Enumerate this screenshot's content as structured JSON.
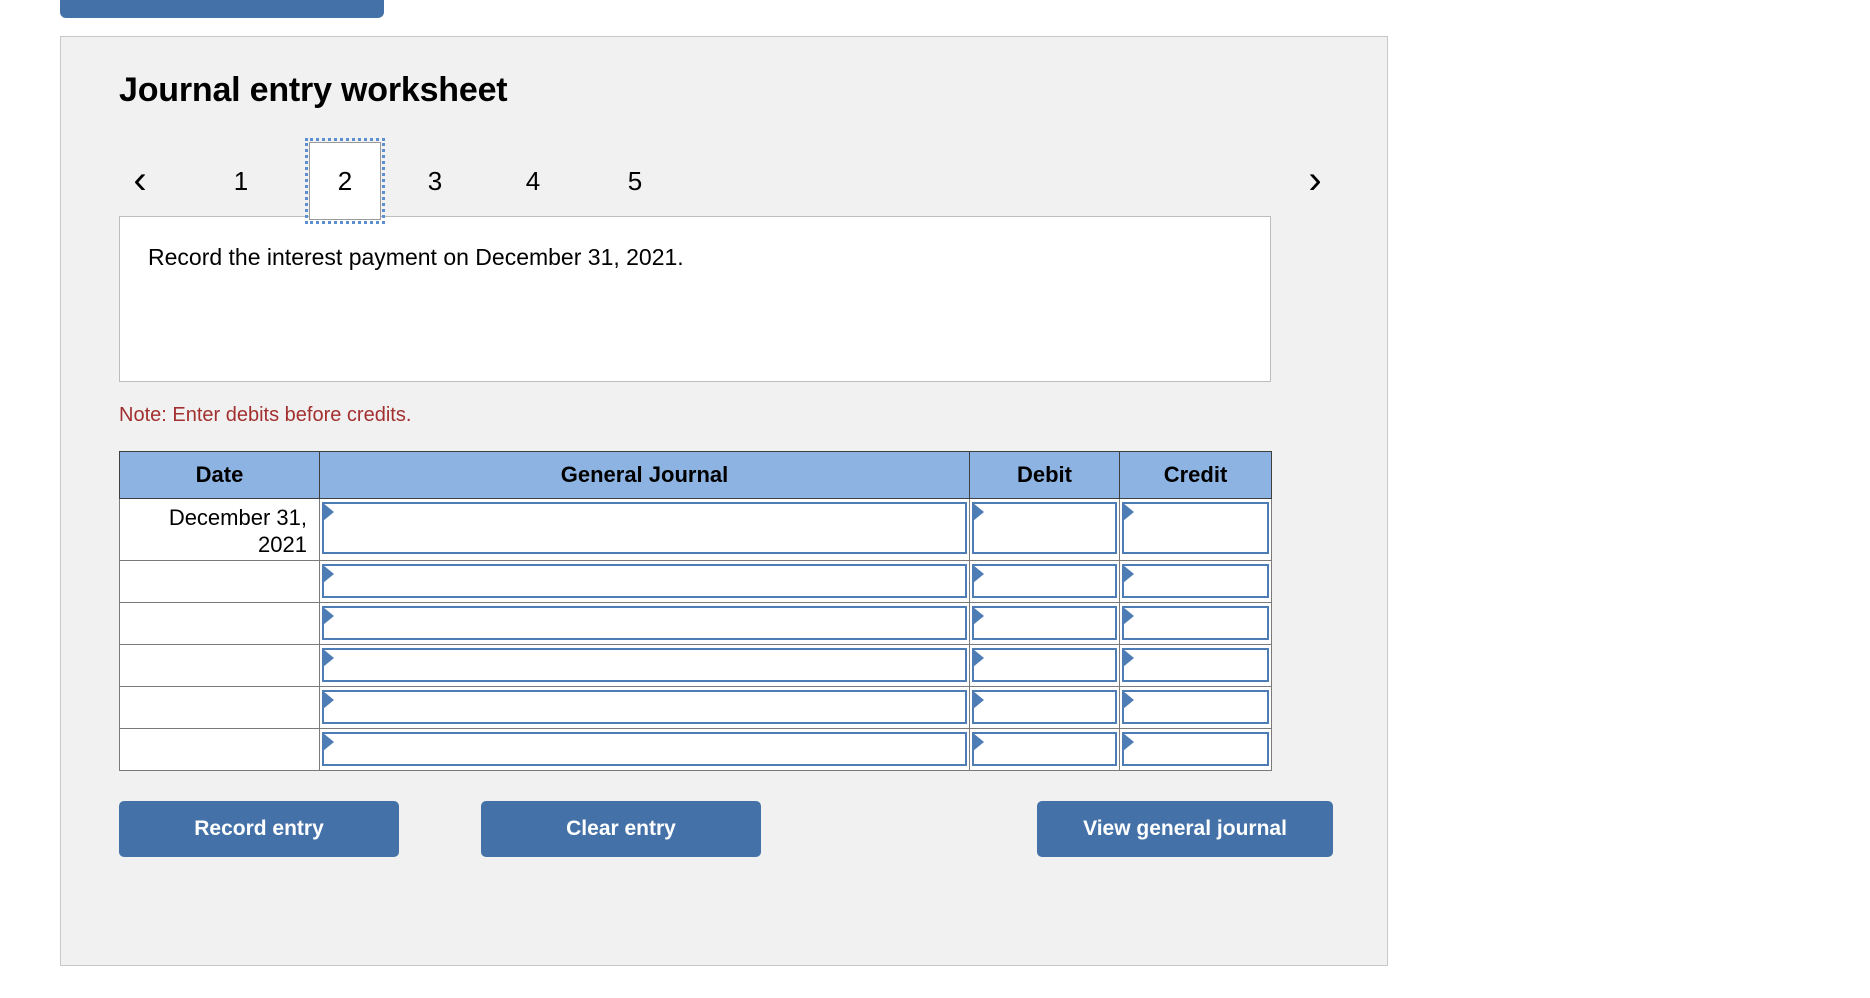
{
  "top_fragment": {
    "name": "partial-blue-tab"
  },
  "panel": {
    "title": "Journal entry worksheet",
    "nav": {
      "prev_icon": "chevron-left-icon",
      "next_icon": "chevron-right-icon",
      "prev_label": "‹",
      "next_label": "›"
    },
    "tabs": [
      {
        "label": "1",
        "active": false
      },
      {
        "label": "2",
        "active": true
      },
      {
        "label": "3",
        "active": false
      },
      {
        "label": "4",
        "active": false
      },
      {
        "label": "5",
        "active": false
      }
    ],
    "description": "Record the interest payment on December 31, 2021.",
    "note": "Note: Enter debits before credits.",
    "table": {
      "headers": [
        "Date",
        "General Journal",
        "Debit",
        "Credit"
      ],
      "rows": [
        {
          "date": "December 31, 2021",
          "general_journal": "",
          "debit": "",
          "credit": ""
        },
        {
          "date": "",
          "general_journal": "",
          "debit": "",
          "credit": ""
        },
        {
          "date": "",
          "general_journal": "",
          "debit": "",
          "credit": ""
        },
        {
          "date": "",
          "general_journal": "",
          "debit": "",
          "credit": ""
        },
        {
          "date": "",
          "general_journal": "",
          "debit": "",
          "credit": ""
        },
        {
          "date": "",
          "general_journal": "",
          "debit": "",
          "credit": ""
        }
      ]
    },
    "buttons": {
      "record": "Record entry",
      "clear": "Clear entry",
      "view": "View general journal"
    }
  },
  "colors": {
    "header_blue": "#8db3e2",
    "button_blue": "#4472a8",
    "panel_bg": "#f1f1f1",
    "note_red": "#a33030",
    "input_border_blue": "#4e7cb5",
    "focus_outline_blue": "#5b8fd0"
  }
}
